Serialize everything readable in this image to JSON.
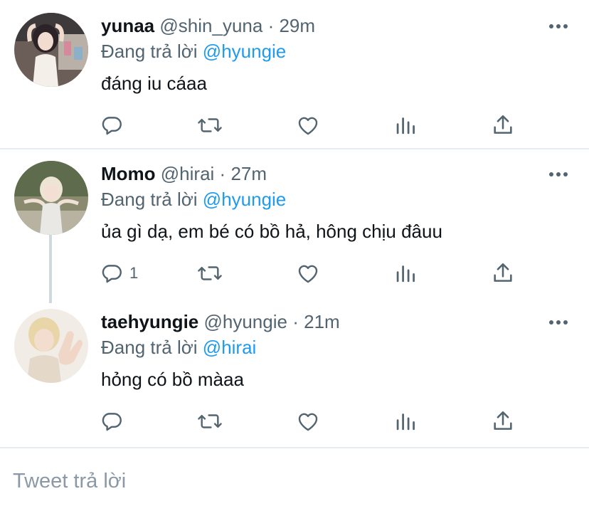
{
  "tweets": [
    {
      "name": "yunaa",
      "handle": "@shin_yuna",
      "dot": "·",
      "time": "29m",
      "replying_prefix": "Đang trả lời",
      "replying_to": "@hyungie",
      "text": "đáng iu cáaa",
      "reply_count": ""
    },
    {
      "name": "Momo",
      "handle": "@hirai",
      "dot": "·",
      "time": "27m",
      "replying_prefix": "Đang trả lời",
      "replying_to": "@hyungie",
      "text": "ủa gì dạ, em bé có bồ hả, hông chịu đâuu",
      "reply_count": "1"
    },
    {
      "name": "taehyungie",
      "handle": "@hyungie",
      "dot": "·",
      "time": "21m",
      "replying_prefix": "Đang trả lời",
      "replying_to": "@hirai",
      "text": "hỏng có bồ màaa",
      "reply_count": ""
    }
  ],
  "composer": {
    "placeholder": "Tweet trả lời"
  },
  "icons": [
    "reply-icon",
    "retweet-icon",
    "like-icon",
    "analytics-icon",
    "share-icon",
    "more-icon"
  ],
  "colors": {
    "link": "#1d9bf0",
    "secondary_text": "#536471",
    "primary_text": "#0f1419",
    "divider": "#e6ecf0"
  }
}
